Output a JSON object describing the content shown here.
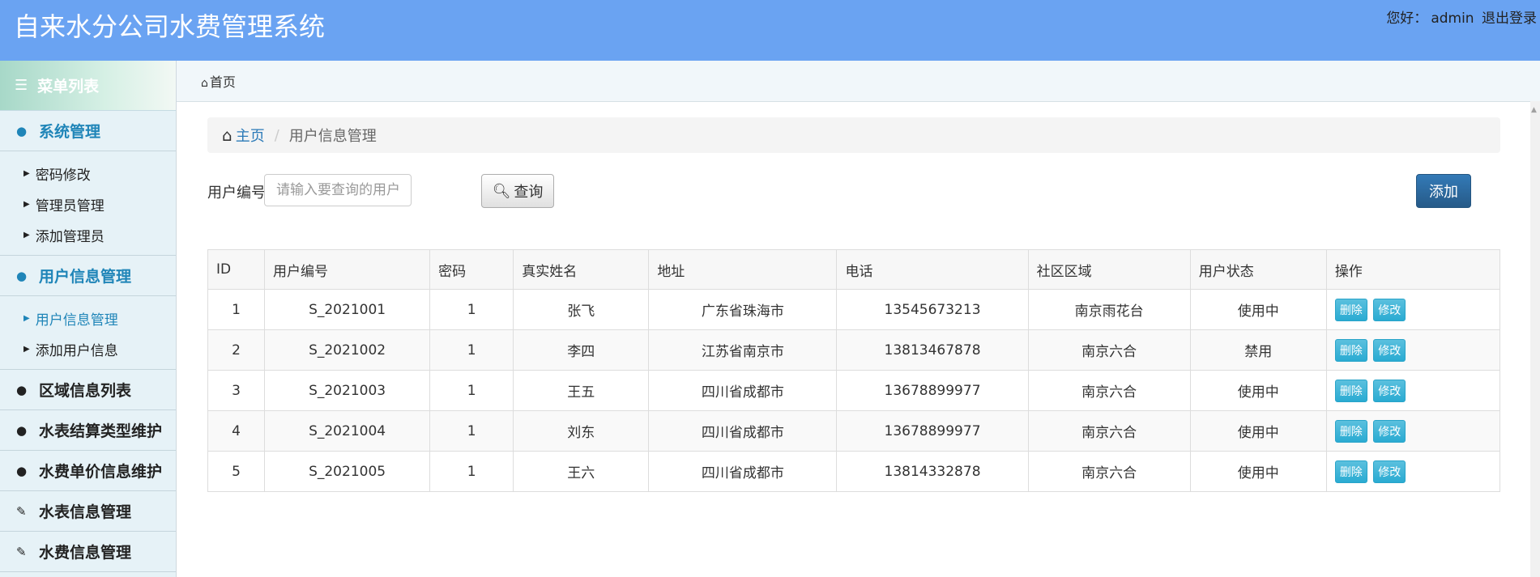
{
  "header": {
    "title": "自来水分公司水费管理系统",
    "greeting": "您好：",
    "username": "admin",
    "logout_label": "退出登录"
  },
  "sidebar": {
    "menu_title": "菜单列表",
    "groups": [
      {
        "label": "系统管理",
        "items": [
          "密码修改",
          "管理员管理",
          "添加管理员"
        ]
      },
      {
        "label": "用户信息管理",
        "items": [
          "用户信息管理",
          "添加用户信息"
        ]
      },
      {
        "label": "区域信息列表"
      },
      {
        "label": "水表结算类型维护"
      },
      {
        "label": "水费单价信息维护"
      },
      {
        "label": "水表信息管理"
      },
      {
        "label": "水费信息管理"
      }
    ]
  },
  "tabbar": {
    "home_tab": "首页"
  },
  "breadcrumb": {
    "home": "主页",
    "current": "用户信息管理"
  },
  "search": {
    "label": "用户编号",
    "placeholder": "请输入要查询的用户编号...",
    "value": "",
    "button_label": "查询"
  },
  "add_label": "添加",
  "table": {
    "columns": [
      "ID",
      "用户编号",
      "密码",
      "真实姓名",
      "地址",
      "电话",
      "社区区域",
      "用户状态",
      "操作"
    ],
    "rows": [
      [
        "1",
        "S_2021001",
        "1",
        "张飞",
        "广东省珠海市",
        "13545673213",
        "南京雨花台",
        "使用中"
      ],
      [
        "2",
        "S_2021002",
        "1",
        "李四",
        "江苏省南京市",
        "13813467878",
        "南京六合",
        "禁用"
      ],
      [
        "3",
        "S_2021003",
        "1",
        "王五",
        "四川省成都市",
        "13678899977",
        "南京六合",
        "使用中"
      ],
      [
        "4",
        "S_2021004",
        "1",
        "刘东",
        "四川省成都市",
        "13678899977",
        "南京六合",
        "使用中"
      ],
      [
        "5",
        "S_2021005",
        "1",
        "王六",
        "四川省成都市",
        "13814332878",
        "南京六合",
        "使用中"
      ]
    ],
    "delete_label": "删除",
    "edit_label": "修改"
  }
}
